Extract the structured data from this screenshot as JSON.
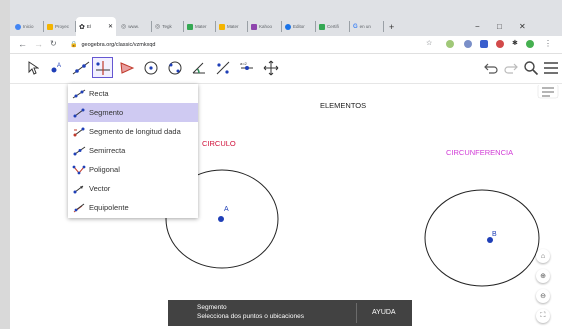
{
  "browser": {
    "tabs": [
      {
        "label": "Inicio",
        "color": "#4285f4"
      },
      {
        "label": "Proyec",
        "color": "#f4b400"
      },
      {
        "label": "El",
        "color": "#666666"
      },
      {
        "label": "www.",
        "color": "#5f6368"
      },
      {
        "label": "Tegk",
        "color": "#5f6368"
      },
      {
        "label": "Mater",
        "color": "#34a853"
      },
      {
        "label": "Mater",
        "color": "#f4b400"
      },
      {
        "label": "Kahoo",
        "color": "#8e44ad"
      },
      {
        "label": "Editor",
        "color": "#1a73e8"
      },
      {
        "label": "Certifi",
        "color": "#34a853"
      },
      {
        "label": "en un",
        "color": "#4285f4"
      }
    ],
    "new_tab": "+",
    "window_controls": {
      "minimize": "−",
      "maximize": "□",
      "close": "✕"
    },
    "url": "geogebra.org/classic/vzmkxqd"
  },
  "menu": {
    "items": [
      {
        "label": "Recta",
        "icon": "line-icon"
      },
      {
        "label": "Segmento",
        "icon": "segment-icon"
      },
      {
        "label": "Segmento de longitud dada",
        "icon": "segment-fixed-length-icon"
      },
      {
        "label": "Semirrecta",
        "icon": "ray-icon"
      },
      {
        "label": "Poligonal",
        "icon": "polyline-icon"
      },
      {
        "label": "Vector",
        "icon": "vector-icon"
      },
      {
        "label": "Equipolente",
        "icon": "vector-from-point-icon"
      }
    ],
    "selected": "Segmento"
  },
  "canvas": {
    "title": "ELEMENTOS",
    "label_circulo": "CIRCULO",
    "label_circunferencia": "CIRCUNFERENCIA",
    "point_a": "A",
    "point_b": "B",
    "colors": {
      "circulo": "#d0103a",
      "circunferencia": "#d13bd6",
      "point": "#1f3fb7"
    }
  },
  "snackbar": {
    "title": "Segmento",
    "subtitle": "Selecciona dos puntos o ubicaciones",
    "help": "AYUDA"
  },
  "accent": "#6557d2"
}
